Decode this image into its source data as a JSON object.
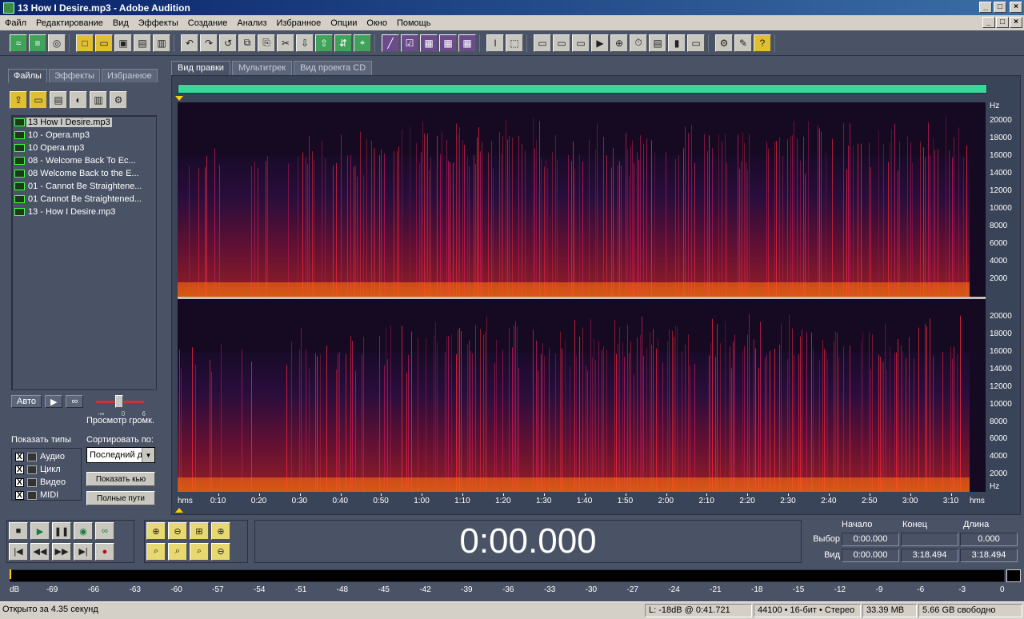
{
  "window": {
    "title": "13 How I Desire.mp3 - Adobe Audition",
    "minimize": "_",
    "maximize": "□",
    "close": "×"
  },
  "menu": {
    "items": [
      "Файл",
      "Редактирование",
      "Вид",
      "Эффекты",
      "Создание",
      "Анализ",
      "Избранное",
      "Опции",
      "Окно",
      "Помощь"
    ]
  },
  "left_panel": {
    "tabs": [
      "Файлы",
      "Эффекты",
      "Избранное"
    ],
    "active_tab": "Файлы",
    "files": [
      "13 How I Desire.mp3",
      "10 - Opera.mp3",
      "10 Opera.mp3",
      "08 - Welcome Back To Ec...",
      "08 Welcome Back to the E...",
      "01 - Cannot Be Straightene...",
      "01 Cannot Be Straightened...",
      "13 - How I Desire.mp3"
    ],
    "selected_file": "13 How I Desire.mp3",
    "auto_button": "Авто",
    "play_icon": "▶",
    "loop_icon": "∞",
    "volume_min": "-∞",
    "volume_mid": "0",
    "volume_max": "6",
    "preview_volume_label": "Просмотр громк.",
    "show_types_label": "Показать типы",
    "types": [
      {
        "label": "Аудио",
        "checked": "X"
      },
      {
        "label": "Цикл",
        "checked": "X"
      },
      {
        "label": "Видео",
        "checked": "X"
      },
      {
        "label": "MIDI",
        "checked": "X"
      }
    ],
    "sort_label": "Сортировать по:",
    "sort_value": "Последний д",
    "show_cue_button": "Показать кью",
    "full_paths_button": "Полные пути"
  },
  "view_tabs": [
    "Вид правки",
    "Мультитрек",
    "Вид проекта CD"
  ],
  "active_view": "Вид правки",
  "editor": {
    "freq_unit": "Hz",
    "freq_ticks": [
      "20000",
      "18000",
      "16000",
      "14000",
      "12000",
      "10000",
      "8000",
      "6000",
      "4000",
      "2000"
    ],
    "time_unit": "hms",
    "time_ticks": [
      "0:10",
      "0:20",
      "0:30",
      "0:40",
      "0:50",
      "1:00",
      "1:10",
      "1:20",
      "1:30",
      "1:40",
      "1:50",
      "2:00",
      "2:10",
      "2:20",
      "2:30",
      "2:40",
      "2:50",
      "3:00",
      "3:10"
    ],
    "duration_seconds": 198.494
  },
  "time_display": "0:00.000",
  "selection": {
    "col_start": "Начало",
    "col_end": "Конец",
    "col_length": "Длина",
    "row_selection": "Выбор",
    "row_view": "Вид",
    "sel_start": "0:00.000",
    "sel_end": "",
    "sel_length": "0.000",
    "view_start": "0:00.000",
    "view_end": "3:18.494",
    "view_length": "3:18.494"
  },
  "level_meter": {
    "labels": [
      "dB",
      "-69",
      "-66",
      "-63",
      "-60",
      "-57",
      "-54",
      "-51",
      "-48",
      "-45",
      "-42",
      "-39",
      "-36",
      "-33",
      "-30",
      "-27",
      "-24",
      "-21",
      "-18",
      "-15",
      "-12",
      "-9",
      "-6",
      "-3",
      "0"
    ]
  },
  "status": {
    "left": "Открыто за 4.35 секунд",
    "level": "L: -18dB @  0:41.721",
    "format": "44100 • 16-бит • Стерео",
    "size": "33.39 MB",
    "free": "5.66 GB свободно"
  },
  "colors": {
    "background": "#4a5366",
    "overview": "#39d89a",
    "spectral_hot": "#ff3030",
    "spectral_dark": "#1a0a2a"
  }
}
